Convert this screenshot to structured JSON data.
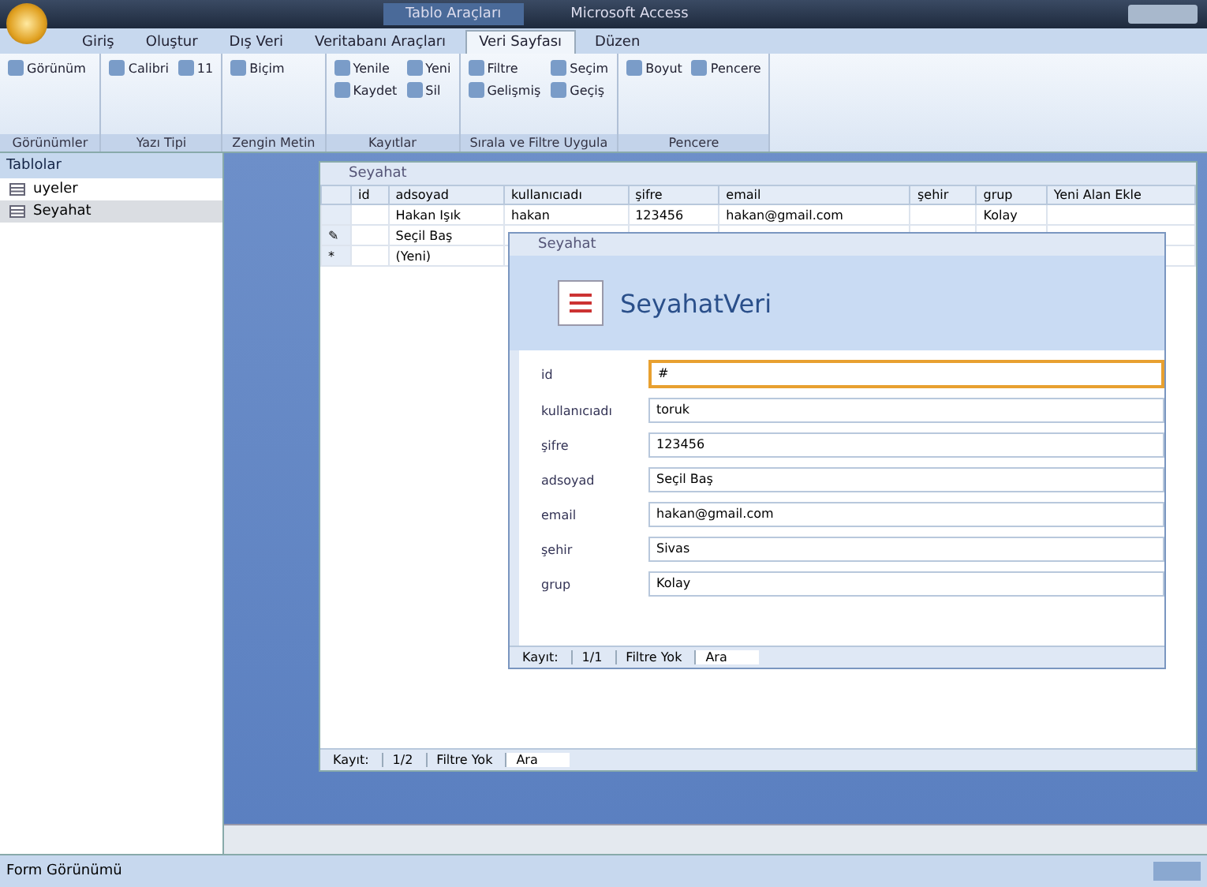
{
  "window": {
    "context_title": "Tablo Araçları",
    "title": "Microsoft Access"
  },
  "tabs": [
    {
      "label": "Giriş",
      "selected": false
    },
    {
      "label": "Oluştur",
      "selected": false
    },
    {
      "label": "Dış Veri",
      "selected": false
    },
    {
      "label": "Veritabanı Araçları",
      "selected": false
    },
    {
      "label": "Veri Sayfası",
      "selected": true
    },
    {
      "label": "Düzen",
      "selected": false
    }
  ],
  "ribbon_groups": [
    {
      "label": "Görünümler",
      "buttons": [
        "Görünüm"
      ]
    },
    {
      "label": "Yazı Tipi",
      "buttons": [
        "Calibri",
        "11"
      ]
    },
    {
      "label": "Zengin Metin",
      "buttons": [
        "Biçim"
      ]
    },
    {
      "label": "Kayıtlar",
      "buttons": [
        "Yenile",
        "Yeni",
        "Kaydet",
        "Sil"
      ]
    },
    {
      "label": "Sırala ve Filtre Uygula",
      "buttons": [
        "Filtre",
        "Seçim",
        "Gelişmiş",
        "Geçiş"
      ]
    },
    {
      "label": "Pencere",
      "buttons": [
        "Boyut",
        "Pencere"
      ]
    }
  ],
  "nav_pane": {
    "title": "Tablolar",
    "items": [
      {
        "label": "uyeler",
        "selected": false
      },
      {
        "label": "Seyahat",
        "selected": true
      }
    ]
  },
  "datasheet": {
    "title": "Seyahat",
    "columns": [
      "id",
      "adsoyad",
      "kullanıcıadı",
      "şifre",
      "email",
      "şehir",
      "grup",
      "Yeni Alan Ekle"
    ],
    "rows": [
      {
        "marker": "",
        "cells": [
          "",
          "Hakan Işık",
          "hakan",
          "123456",
          "hakan@gmail.com",
          "",
          "Kolay"
        ]
      },
      {
        "marker": "✎",
        "cells": [
          "",
          "Seçil Baş",
          "",
          "",
          "",
          "",
          ""
        ]
      },
      {
        "marker": "*",
        "cells": [
          "",
          "(Yeni)",
          "",
          "",
          "",
          "",
          ""
        ]
      }
    ],
    "nav": {
      "label": "Kayıt:",
      "position": "1/2",
      "filter": "Filtre Yok",
      "search": "Ara"
    }
  },
  "form": {
    "title": "Seyahat",
    "heading": "SeyahatVeri",
    "fields": [
      {
        "label": "id",
        "value": "#",
        "focused": true
      },
      {
        "label": "kullanıcıadı",
        "value": "toruk",
        "focused": false
      },
      {
        "label": "şifre",
        "value": "123456",
        "focused": false
      },
      {
        "label": "adsoyad",
        "value": "Seçil Baş",
        "focused": false
      },
      {
        "label": "email",
        "value": "hakan@gmail.com",
        "focused": false
      },
      {
        "label": "şehir",
        "value": "Sivas",
        "focused": false
      },
      {
        "label": "grup",
        "value": "Kolay",
        "focused": false
      }
    ],
    "nav": {
      "label": "Kayıt:",
      "position": "1/1",
      "filter": "Filtre Yok",
      "search": "Ara"
    }
  },
  "status_bar": {
    "text": "Form Görünümü"
  }
}
